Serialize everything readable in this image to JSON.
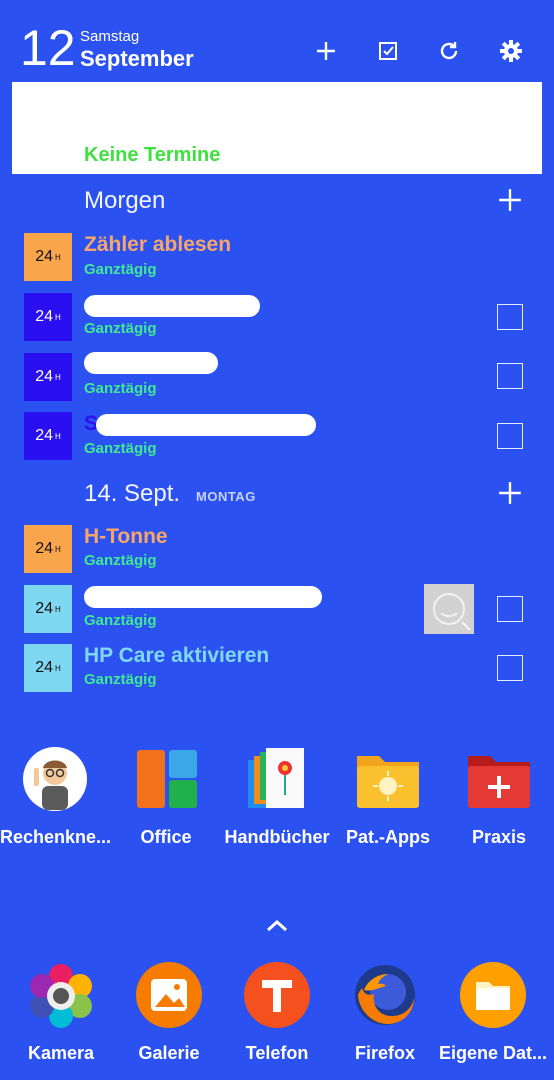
{
  "header": {
    "day_number": "12",
    "weekday": "Samstag",
    "month": "September"
  },
  "today": {
    "empty_text": "Keine Termine"
  },
  "sections": [
    {
      "title": "Morgen",
      "subtitle": ""
    },
    {
      "title": "14. Sept.",
      "subtitle": "MONTAG"
    }
  ],
  "events": [
    {
      "badge": "24",
      "badge_sup": "H",
      "title": "Zähler ablesen",
      "sub": "Ganztägig",
      "badge_color": "#f8a54c",
      "title_color": "#f8a56a"
    },
    {
      "badge": "24",
      "badge_sup": "H",
      "title": "",
      "sub": "Ganztägig",
      "badge_color": "#2a0ff0",
      "title_color": "#2a0ff0"
    },
    {
      "badge": "24",
      "badge_sup": "H",
      "title": "",
      "sub": "Ganztägig",
      "badge_color": "#2a0ff0",
      "title_color": "#2a0ff0"
    },
    {
      "badge": "24",
      "badge_sup": "H",
      "title": "S",
      "sub": "Ganztägig",
      "badge_color": "#2a0ff0",
      "title_color": "#2a0ff0"
    },
    {
      "badge": "24",
      "badge_sup": "H",
      "title": "H-Tonne",
      "sub": "Ganztägig",
      "badge_color": "#f8a54c",
      "title_color": "#f8a56a"
    },
    {
      "badge": "24",
      "badge_sup": "H",
      "title": "",
      "sub": "Ganztägig",
      "badge_color": "#7fd8f2",
      "title_color": "#7fd8f2"
    },
    {
      "badge": "24",
      "badge_sup": "H",
      "title": "HP Care aktivieren",
      "sub": "Ganztägig",
      "badge_color": "#7fd8f2",
      "title_color": "#7fd8f2"
    }
  ],
  "apps": [
    {
      "label": "Rechenkne...",
      "icon": "avatar-professor-icon"
    },
    {
      "label": "Office",
      "icon": "office-folder-icon"
    },
    {
      "label": "Handbücher",
      "icon": "manuals-folder-icon"
    },
    {
      "label": "Pat.-Apps",
      "icon": "pat-apps-folder-icon"
    },
    {
      "label": "Praxis",
      "icon": "praxis-folder-icon"
    }
  ],
  "dock": [
    {
      "label": "Kamera",
      "icon": "camera-icon"
    },
    {
      "label": "Galerie",
      "icon": "gallery-icon"
    },
    {
      "label": "Telefon",
      "icon": "phone-icon"
    },
    {
      "label": "Firefox",
      "icon": "firefox-icon"
    },
    {
      "label": "Eigene Dat...",
      "icon": "my-files-icon"
    }
  ],
  "colors": {
    "background": "#2b52f0",
    "accent_green": "#3fe896",
    "empty_green": "#3fe03f"
  }
}
